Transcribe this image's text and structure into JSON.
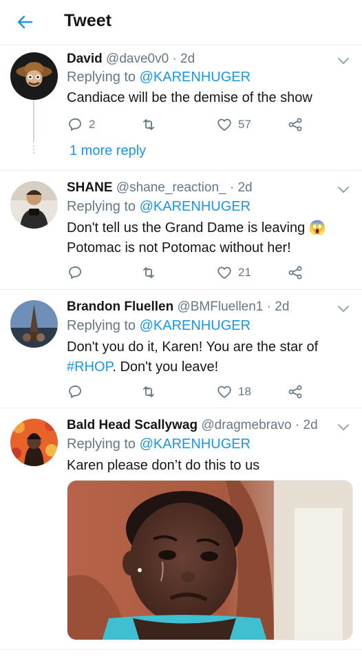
{
  "header": {
    "title": "Tweet"
  },
  "tweets": [
    {
      "name": "David",
      "handle": "@dave0v0",
      "dot": "·",
      "time": "2d",
      "replying_prefix": "Replying to",
      "replying_to": "@KARENHUGER",
      "text": "Candiace will be the demise of the show",
      "replies": "2",
      "retweets": "",
      "likes": "57",
      "more_replies": "1 more reply"
    },
    {
      "name": "SHANE",
      "handle": "@shane_reaction_",
      "dot": "·",
      "time": "2d",
      "replying_prefix": "Replying to",
      "replying_to": "@KARENHUGER",
      "text_line1": "Don't tell us the Grand Dame is leaving",
      "emoji": "😱",
      "text_line2": "Potomac is not Potomac without her!",
      "replies": "",
      "retweets": "",
      "likes": "21"
    },
    {
      "name": "Brandon Fluellen",
      "handle": "@BMFluellen1",
      "dot": "·",
      "time": "2d",
      "replying_prefix": "Replying to",
      "replying_to": "@KARENHUGER",
      "text_line1": "Don't you do it, Karen! You are the star of",
      "hashtag": "#RHOP",
      "text_line2_rest": ". Don't you leave!",
      "replies": "",
      "retweets": "",
      "likes": "18"
    },
    {
      "name": "Bald Head Scallywag",
      "handle": "@dragmebravo",
      "dot": "·",
      "time": "2d",
      "replying_prefix": "Replying to",
      "replying_to": "@KARENHUGER",
      "text": "Karen please don’t do this to us"
    }
  ],
  "colors": {
    "accent": "#1b95e0",
    "muted": "#657786",
    "text": "#14171a",
    "border": "#e6ecf0"
  },
  "icons": [
    "back-arrow-icon",
    "chevron-down-icon",
    "reply-icon",
    "retweet-icon",
    "heart-icon",
    "share-icon"
  ]
}
